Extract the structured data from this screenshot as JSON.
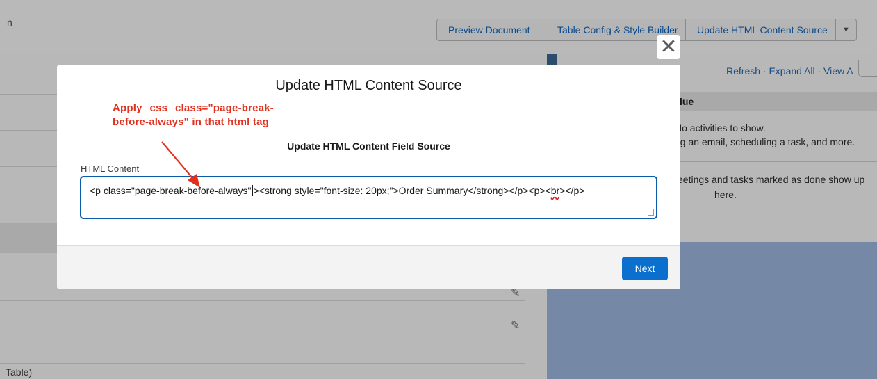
{
  "topbar": {
    "left_fragment": "n",
    "buttons": [
      "Preview Document",
      "Table Config & Style Builder",
      "Update HTML Content Source"
    ],
    "dropdown_icon": "caret-down-icon"
  },
  "left_panel": {
    "footer_fragment": "Table)",
    "edit_icon": "pencil-icon"
  },
  "right_panel": {
    "links": "Refresh  ·  Expand All  ·  View A",
    "header_fragment": "lue",
    "line1": "No activities to show.",
    "line2": "ng an email, scheduling a task, and more.",
    "line3": "eetings and tasks marked as done show up",
    "line4": "here."
  },
  "modal": {
    "close_icon": "close-icon",
    "close_glyph": "✕",
    "title": "Update HTML Content Source",
    "section_title": "Update HTML Content Field Source",
    "field_label": "HTML Content",
    "field_value_before_caret": "<p class=\"page-break-before-always\"",
    "field_value_after_caret": "><strong style=\"font-size: 20px;\">Order Summary</strong></p><p><",
    "field_value_squiggle": "br",
    "field_value_end": "></p>",
    "next_label": "Next"
  },
  "annotation": {
    "text": "Apply css class=\"page-break-before-always\" in that html tag",
    "color": "#e0311f"
  }
}
